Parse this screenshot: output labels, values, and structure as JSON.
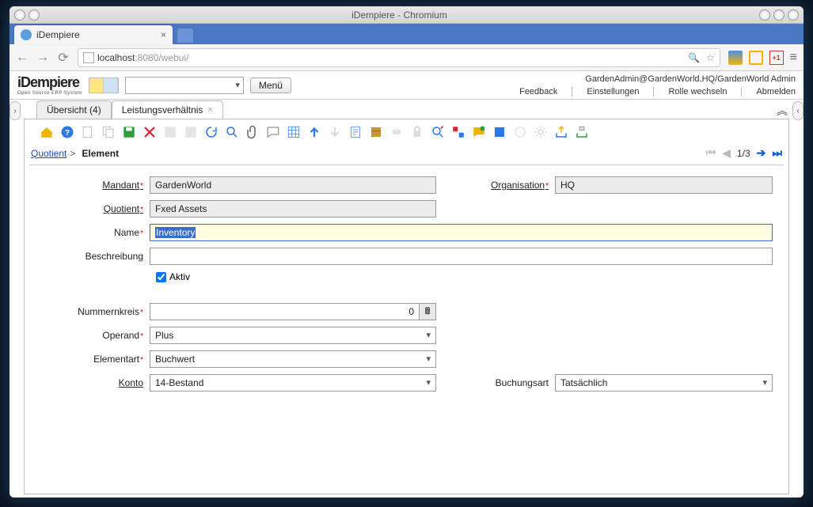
{
  "window": {
    "title": "iDempiere - Chromium"
  },
  "browser": {
    "tab_title": "iDempiere",
    "url_host": "localhost",
    "url_rest": ":8080/webui/"
  },
  "app": {
    "logo": "iDempiere",
    "logo_sub": "Open Source ERP System",
    "menu_button": "Menü",
    "userline": "GardenAdmin@GardenWorld.HQ/GardenWorld Admin",
    "header_links": {
      "feedback": "Feedback",
      "settings": "Einstellungen",
      "change_role": "Rolle wechseln",
      "logout": "Abmelden"
    }
  },
  "tabs": {
    "overview": "Übersicht (4)",
    "active": "Leistungsverhältnis"
  },
  "breadcrumb": {
    "root": "Quotient",
    "current": "Element"
  },
  "pager": {
    "text": "1/3"
  },
  "form": {
    "labels": {
      "mandant": "Mandant",
      "organisation": "Organisation",
      "quotient": "Quotient",
      "name": "Name",
      "beschreibung": "Beschreibung",
      "aktiv": "Aktiv",
      "nummernkreis": "Nummernkreis",
      "operand": "Operand",
      "elementart": "Elementart",
      "konto": "Konto",
      "buchungsart": "Buchungsart"
    },
    "values": {
      "mandant": "GardenWorld",
      "organisation": "HQ",
      "quotient": "Fxed Assets",
      "name": "Inventory",
      "beschreibung": "",
      "aktiv": true,
      "nummernkreis": "0",
      "operand": "Plus",
      "elementart": "Buchwert",
      "konto": "14-Bestand",
      "buchungsart": "Tatsächlich"
    }
  }
}
